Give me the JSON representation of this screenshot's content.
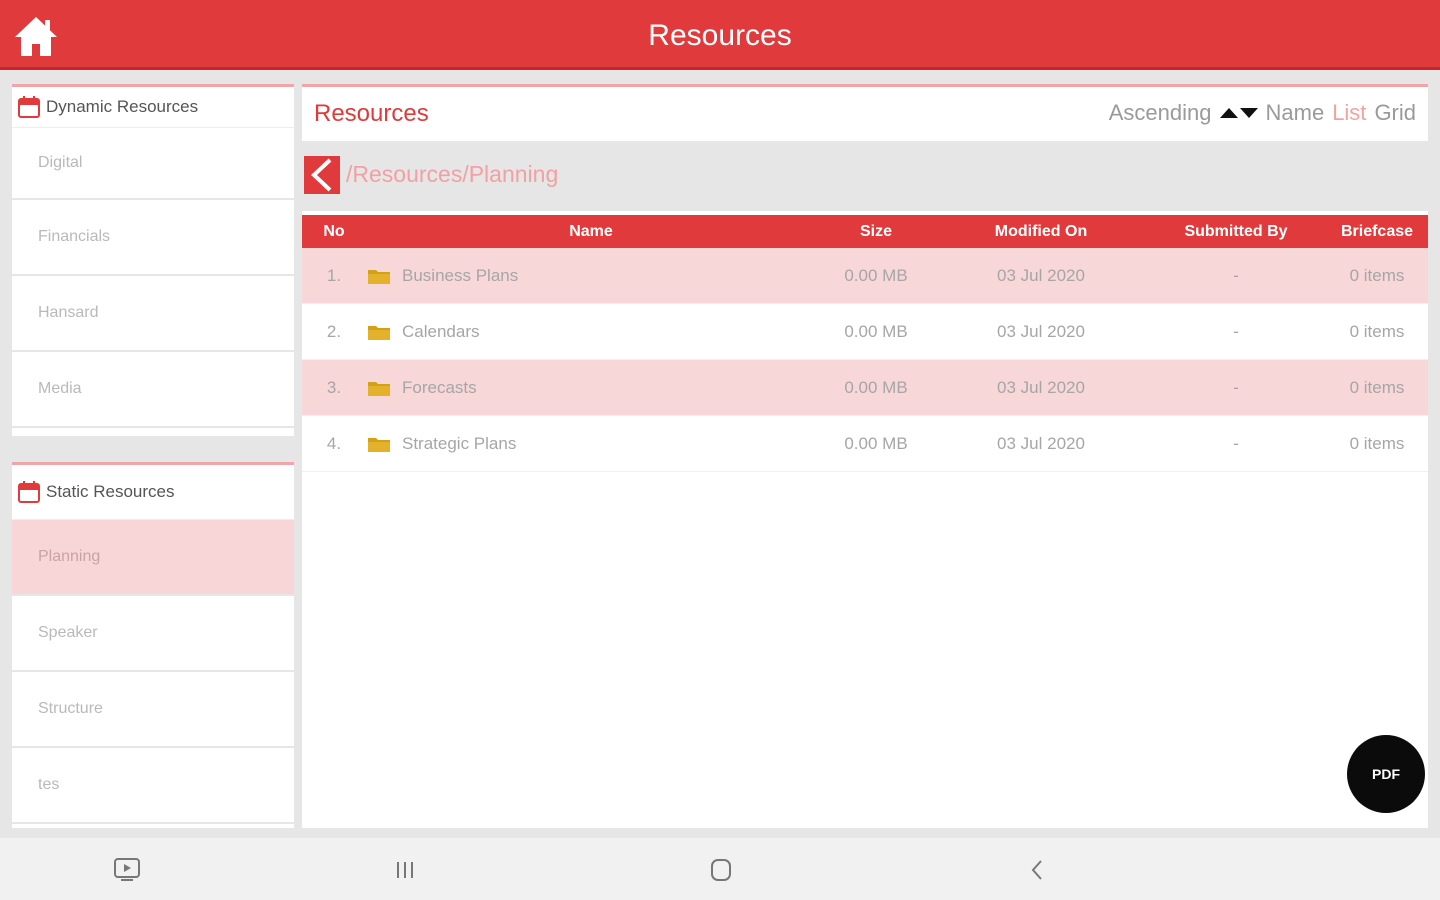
{
  "appbar": {
    "title": "Resources"
  },
  "sidebar": {
    "dynamic": {
      "title": "Dynamic Resources",
      "items": [
        {
          "label": "Digital"
        },
        {
          "label": "Financials"
        },
        {
          "label": "Hansard"
        },
        {
          "label": "Media"
        }
      ]
    },
    "static": {
      "title": "Static Resources",
      "items": [
        {
          "label": "Planning"
        },
        {
          "label": "Speaker"
        },
        {
          "label": "Structure"
        },
        {
          "label": "tes"
        }
      ]
    }
  },
  "main": {
    "title": "Resources",
    "toolbar": {
      "sort_order": "Ascending",
      "sort_field": "Name",
      "view_list": "List",
      "view_grid": "Grid"
    },
    "breadcrumb": "/Resources/Planning",
    "table": {
      "headers": {
        "no": "No",
        "name": "Name",
        "size": "Size",
        "modified": "Modified On",
        "submitted": "Submitted By",
        "briefcase": "Briefcase"
      },
      "rows": [
        {
          "no": "1.",
          "name": "Business Plans",
          "size": "0.00 MB",
          "modified": "03 Jul 2020",
          "submitted": "-",
          "briefcase": "0 items"
        },
        {
          "no": "2.",
          "name": "Calendars",
          "size": "0.00 MB",
          "modified": "03 Jul 2020",
          "submitted": "-",
          "briefcase": "0 items"
        },
        {
          "no": "3.",
          "name": "Forecasts",
          "size": "0.00 MB",
          "modified": "03 Jul 2020",
          "submitted": "-",
          "briefcase": "0 items"
        },
        {
          "no": "4.",
          "name": "Strategic Plans",
          "size": "0.00 MB",
          "modified": "03 Jul 2020",
          "submitted": "-",
          "briefcase": "0 items"
        }
      ]
    }
  },
  "fab": {
    "label": "PDF"
  },
  "colors": {
    "accent": "#e03a3c",
    "row_highlight": "#f8d7d8",
    "folder": "#d4a017"
  }
}
